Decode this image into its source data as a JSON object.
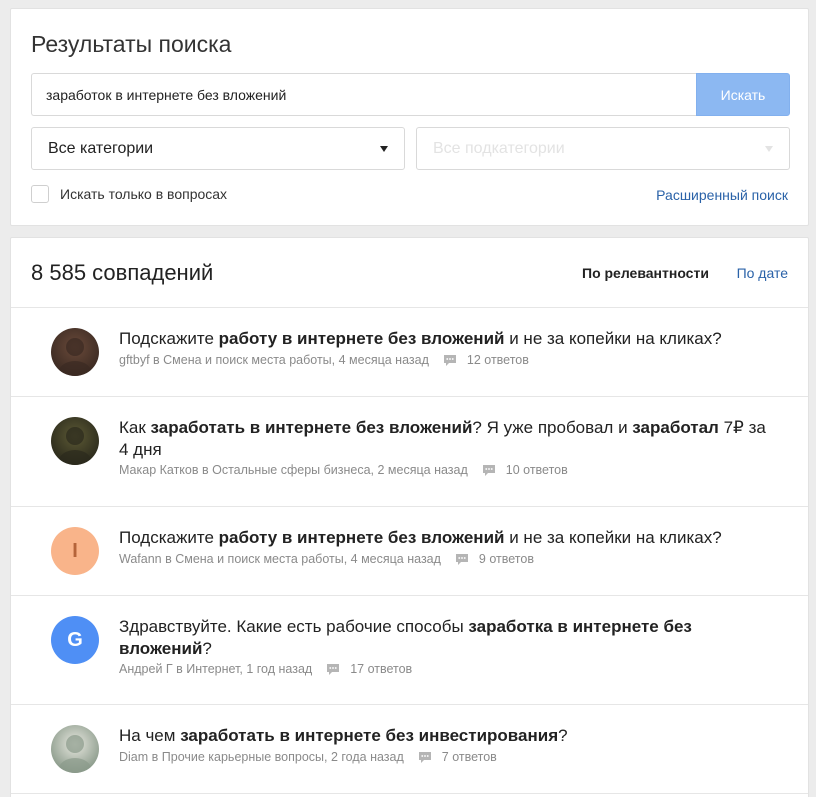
{
  "search": {
    "title": "Результаты поиска",
    "query": "заработок в интернете без вложений",
    "button_label": "Искать",
    "category_label": "Все категории",
    "subcategory_label": "Все подкатегории",
    "questions_only_label": "Искать только в вопросах",
    "questions_only_checked": false,
    "advanced_link": "Расширенный поиск"
  },
  "results": {
    "count_label": "8 585 совпадений",
    "sort_relevance": "По релевантности",
    "sort_date": "По дате",
    "items": [
      {
        "parts": [
          {
            "text": "Подскажите ",
            "bold": false
          },
          {
            "text": "работу в интернете без вложений",
            "bold": true
          },
          {
            "text": " и не за копейки на кликах?",
            "bold": false
          }
        ],
        "meta": "gftbyf в Смена и поиск места работы, 4 месяца назад",
        "answers": "12 ответов",
        "avatar": {
          "type": "photo",
          "name": "user-photo-icon",
          "colors": [
            "#3b2a22",
            "#6a4a3a"
          ]
        }
      },
      {
        "parts": [
          {
            "text": "Как ",
            "bold": false
          },
          {
            "text": "заработать в интернете без вложений",
            "bold": true
          },
          {
            "text": "? Я уже пробовал и ",
            "bold": false
          },
          {
            "text": "заработал",
            "bold": true
          },
          {
            "text": " 7₽ за 4 дня",
            "bold": false
          }
        ],
        "meta": "Макар Катков в Остальные сферы бизнеса, 2 месяца назад",
        "answers": "10 ответов",
        "avatar": {
          "type": "photo",
          "name": "user-photo-icon",
          "colors": [
            "#2b2a1c",
            "#5d5a35"
          ]
        }
      },
      {
        "parts": [
          {
            "text": "Подскажите ",
            "bold": false
          },
          {
            "text": "работу в интернете без вложений",
            "bold": true
          },
          {
            "text": " и не за копейки на кликах?",
            "bold": false
          }
        ],
        "meta": "Wafann в Смена и поиск места работы, 4 месяца назад",
        "answers": "9 ответов",
        "avatar": {
          "type": "letter",
          "letter": "I",
          "bg": "#f9b48a",
          "fg": "#b5643a"
        }
      },
      {
        "parts": [
          {
            "text": "Здравствуйте. Какие есть рабочие способы ",
            "bold": false
          },
          {
            "text": "заработка в интернете без вложений",
            "bold": true
          },
          {
            "text": "?",
            "bold": false
          }
        ],
        "meta": "Андрей  Г в Интернет, 1 год назад",
        "answers": "17 ответов",
        "avatar": {
          "type": "letter",
          "letter": "G",
          "bg": "#4f8ff5",
          "fg": "#ffffff"
        }
      },
      {
        "parts": [
          {
            "text": "На чем ",
            "bold": false
          },
          {
            "text": "заработать в интернете без инвестирования",
            "bold": true
          },
          {
            "text": "?",
            "bold": false
          }
        ],
        "meta": "Diam в Прочие карьерные вопросы, 2 года назад",
        "answers": "7 ответов",
        "avatar": {
          "type": "photo",
          "name": "user-photo-icon",
          "colors": [
            "#8a9a8a",
            "#e8e8e0"
          ]
        }
      }
    ]
  },
  "colors": {
    "accent": "#2a62a8",
    "button_bg": "#8cb8f2",
    "meta_text": "#8a8a8a"
  }
}
